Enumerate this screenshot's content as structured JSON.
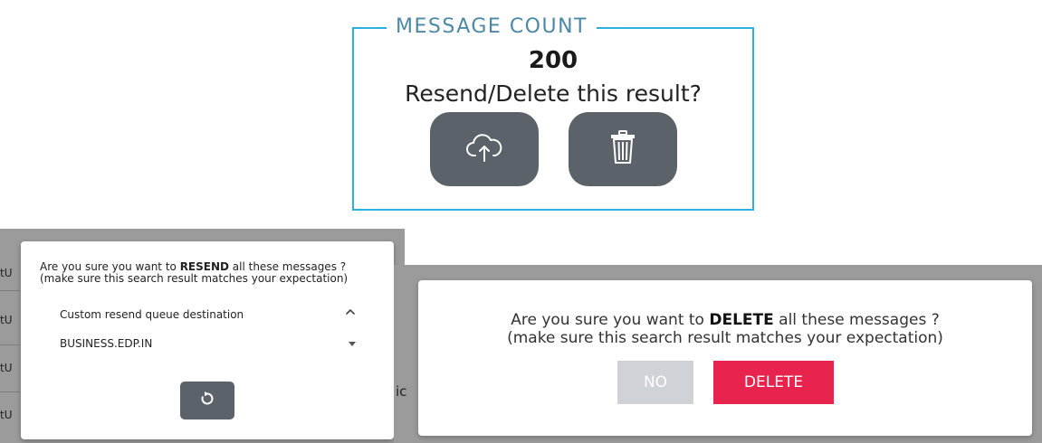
{
  "message_count": {
    "legend": "MESSAGE COUNT",
    "value": "200",
    "question": "Resend/Delete this result?",
    "resend_icon": "cloud-upload-icon",
    "delete_icon": "trash-icon",
    "border_color": "#2bb0e0",
    "button_color": "#5b6269"
  },
  "resend_dialog": {
    "line1_prefix": "Are you sure you want to ",
    "line1_emphasis": "RESEND",
    "line1_suffix": " all these messages ?",
    "line2": "(make sure this search result matches your expectation)",
    "destination_label": "Custom resend queue destination",
    "destination_value": "BUSINESS.EDP.IN",
    "confirm_icon": "refresh-icon",
    "collapse_icon": "chevron-up-icon"
  },
  "delete_dialog": {
    "line1_prefix": "Are you sure you want to ",
    "line1_emphasis": "DELETE",
    "line1_suffix": " all these messages ?",
    "line2": "(make sure this search result matches your expectation)",
    "no_label": "NO",
    "delete_label": "DELETE",
    "delete_color": "#e8234d",
    "no_color": "#cfd3d7"
  },
  "background_fragments": {
    "left_rows": [
      "tU",
      "tU",
      "tU",
      "tU"
    ],
    "right_text": "ic"
  }
}
